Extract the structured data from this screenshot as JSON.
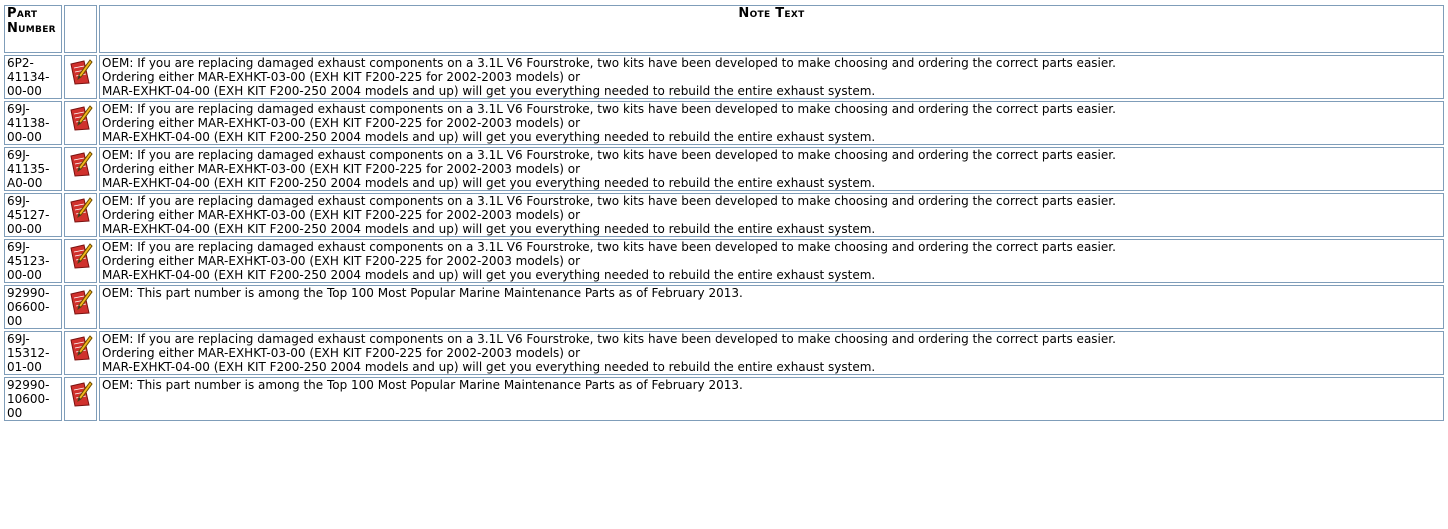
{
  "header": {
    "part_number_label": "Part Number",
    "note_text_label": "Note Text"
  },
  "rows": [
    {
      "part_number": "6P2-\n41134-\n00-00",
      "note": "OEM: If you are replacing damaged exhaust components on a 3.1L V6 Fourstroke, two kits have been developed to make choosing and ordering the correct parts easier.\nOrdering either MAR-EXHKT-03-00 (EXH KIT F200-225 for 2002-2003 models) or\n MAR-EXHKT-04-00 (EXH KIT F200-250 2004 models and up) will get you everything needed to rebuild the entire exhaust system.",
      "icon": "note-pencil-icon"
    },
    {
      "part_number": "69J-\n41138-\n00-00",
      "note": "OEM: If you are replacing damaged exhaust components on a 3.1L V6 Fourstroke, two kits have been developed to make choosing and ordering the correct parts easier.\nOrdering either MAR-EXHKT-03-00 (EXH KIT F200-225 for 2002-2003 models) or\n MAR-EXHKT-04-00 (EXH KIT F200-250 2004 models and up) will get you everything needed to rebuild the entire exhaust system.",
      "icon": "note-pencil-icon"
    },
    {
      "part_number": "69J-\n41135-\nA0-00",
      "note": "OEM: If you are replacing damaged exhaust components on a 3.1L V6 Fourstroke, two kits have been developed to make choosing and ordering the correct parts easier.\nOrdering either MAR-EXHKT-03-00 (EXH KIT F200-225 for 2002-2003 models) or\n MAR-EXHKT-04-00 (EXH KIT F200-250 2004 models and up) will get you everything needed to rebuild the entire exhaust system.",
      "icon": "note-pencil-icon"
    },
    {
      "part_number": "69J-\n45127-\n00-00",
      "note": "OEM: If you are replacing damaged exhaust components on a 3.1L V6 Fourstroke, two kits have been developed to make choosing and ordering the correct parts easier.\nOrdering either MAR-EXHKT-03-00 (EXH KIT F200-225 for 2002-2003 models) or\n MAR-EXHKT-04-00 (EXH KIT F200-250 2004 models and up) will get you everything needed to rebuild the entire exhaust system.",
      "icon": "note-pencil-icon"
    },
    {
      "part_number": "69J-\n45123-\n00-00",
      "note": "OEM: If you are replacing damaged exhaust components on a 3.1L V6 Fourstroke, two kits have been developed to make choosing and ordering the correct parts easier.\nOrdering either MAR-EXHKT-03-00 (EXH KIT F200-225 for 2002-2003 models) or\n MAR-EXHKT-04-00 (EXH KIT F200-250 2004 models and up) will get you everything needed to rebuild the entire exhaust system.",
      "icon": "note-pencil-icon"
    },
    {
      "part_number": "92990-\n06600-00",
      "note": "OEM: This part number is among the Top 100 Most Popular Marine Maintenance Parts as of February 2013.",
      "icon": "note-pencil-icon"
    },
    {
      "part_number": "69J-\n15312-\n01-00",
      "note": "OEM: If you are replacing damaged exhaust components on a 3.1L V6 Fourstroke, two kits have been developed to make choosing and ordering the correct parts easier.\nOrdering either MAR-EXHKT-03-00 (EXH KIT F200-225 for 2002-2003 models) or\n MAR-EXHKT-04-00 (EXH KIT F200-250 2004 models and up) will get you everything needed to rebuild the entire exhaust system.",
      "icon": "note-pencil-icon"
    },
    {
      "part_number": "92990-\n10600-00",
      "note": "OEM: This part number is among the Top 100 Most Popular Marine Maintenance Parts as of February 2013.",
      "icon": "note-pencil-icon"
    }
  ],
  "colors": {
    "border": "#7f9db9",
    "icon_red": "#d0312d",
    "icon_pencil": "#f2b81c"
  }
}
